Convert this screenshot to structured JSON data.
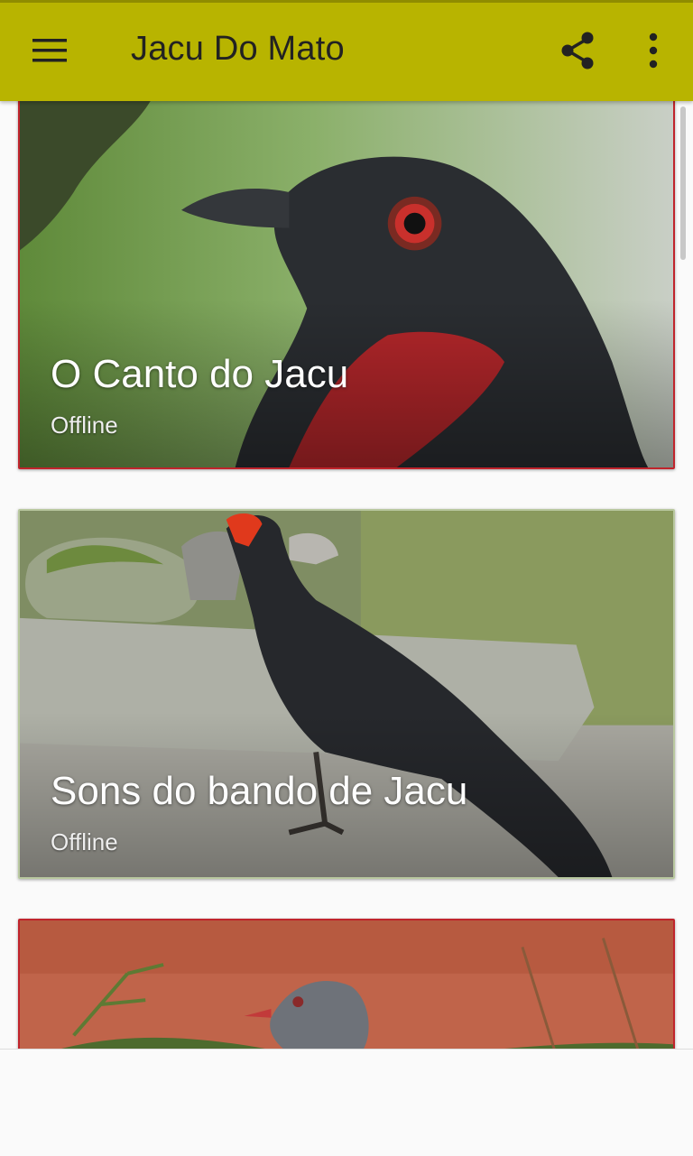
{
  "app": {
    "title": "Jacu Do Mato",
    "accent_color": "#b8b400"
  },
  "toolbar": {
    "menu_icon": "hamburger-menu-icon",
    "share_icon": "share-icon",
    "more_icon": "more-vert-icon"
  },
  "cards": [
    {
      "title": "O Canto do Jacu",
      "subtitle": "Offline"
    },
    {
      "title": "Sons do bando de Jacu",
      "subtitle": "Offline"
    },
    {
      "title": "",
      "subtitle": ""
    }
  ]
}
